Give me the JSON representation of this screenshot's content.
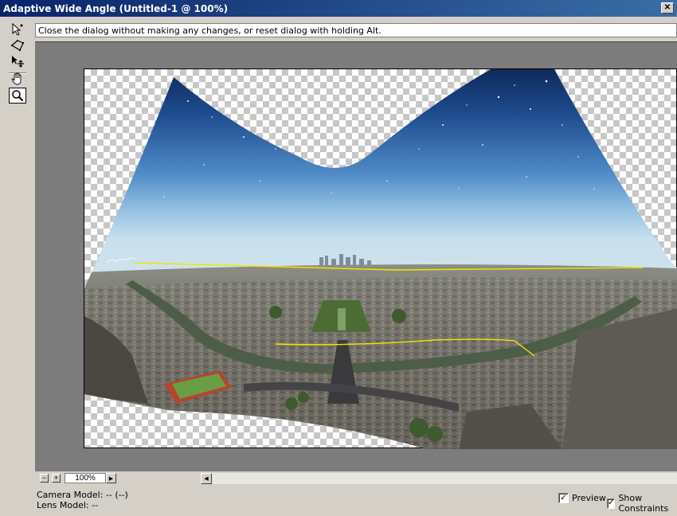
{
  "window": {
    "title": "Adaptive Wide Angle (Untitled-1 @ 100%)",
    "close_label": "✕"
  },
  "tools": [
    {
      "name": "constraint-tool",
      "icon": "arrow-pointer-icon"
    },
    {
      "name": "polygon-constraint-tool",
      "icon": "polygon-icon"
    },
    {
      "name": "move-tool",
      "icon": "move-arrow-icon"
    },
    {
      "name": "hand-tool",
      "icon": "hand-icon"
    },
    {
      "name": "zoom-tool",
      "icon": "magnifier-icon",
      "selected": true
    }
  ],
  "hint": {
    "text": "Close the dialog without making any changes, or reset dialog with holding Alt."
  },
  "zoom": {
    "minus_label": "−",
    "plus_label": "+",
    "value": "100%",
    "arrow_label": "▶"
  },
  "scrollbar": {
    "left_arrow": "◀"
  },
  "info": {
    "camera_model": "Camera Model: -- (--)",
    "lens_model": "Lens Model: --"
  },
  "options": {
    "preview_label": "Preview",
    "preview_checked": true,
    "show_constraints_label": "Show Constraints",
    "show_constraints_checked": true,
    "check_mark": "✓"
  },
  "colors": {
    "titlebar_start": "#0a246a",
    "titlebar_end": "#3a6ea5",
    "dialog_bg": "#d4d0c8",
    "canvas_bg": "#7c7c7c",
    "constraint_line": "#f2e600"
  }
}
